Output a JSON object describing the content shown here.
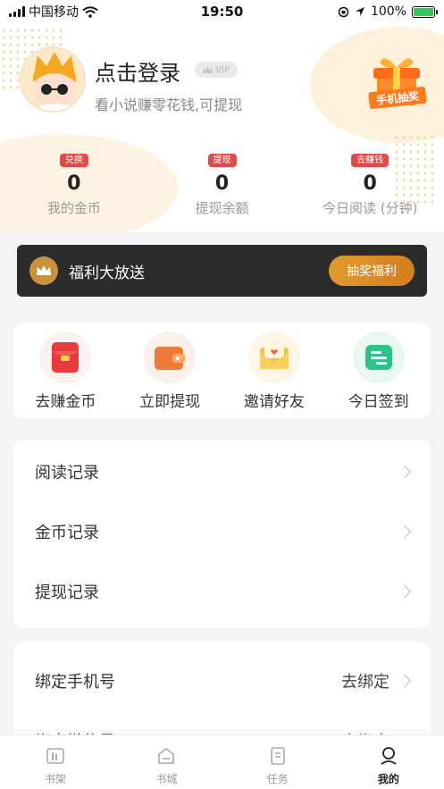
{
  "status_bar": {
    "carrier": "中国移动",
    "time": "19:50",
    "battery": "100%"
  },
  "profile": {
    "login_title": "点击登录",
    "vip_label": "VIP",
    "subtitle": "看小说赚零花钱,可提现",
    "lottery_label": "手机抽奖"
  },
  "stats": [
    {
      "badge": "兑换",
      "value": "0",
      "label": "我的金币"
    },
    {
      "badge": "提现",
      "value": "0",
      "label": "提现余额"
    },
    {
      "badge": "去赚钱",
      "value": "0",
      "label": "今日阅读 (分钟)"
    }
  ],
  "welfare": {
    "title": "福利大放送",
    "button": "抽奖福利"
  },
  "actions": [
    {
      "label": "去赚金币",
      "icon": "red-envelope-icon",
      "color": "#e83a3a"
    },
    {
      "label": "立即提现",
      "icon": "wallet-icon",
      "color": "#f07a3a"
    },
    {
      "label": "邀请好友",
      "icon": "invite-letter-icon",
      "color": "#f5c23a"
    },
    {
      "label": "今日签到",
      "icon": "checkin-icon",
      "color": "#2ec28a"
    }
  ],
  "records": [
    {
      "label": "阅读记录"
    },
    {
      "label": "金币记录"
    },
    {
      "label": "提现记录"
    }
  ],
  "bindings": [
    {
      "label": "绑定手机号",
      "value": "去绑定"
    },
    {
      "label": "绑定微信号",
      "value": "去绑定"
    }
  ],
  "tabs": [
    {
      "label": "书架",
      "icon": "bookshelf-icon"
    },
    {
      "label": "书城",
      "icon": "bookstore-icon"
    },
    {
      "label": "任务",
      "icon": "task-icon"
    },
    {
      "label": "我的",
      "icon": "profile-icon",
      "active": true
    }
  ]
}
